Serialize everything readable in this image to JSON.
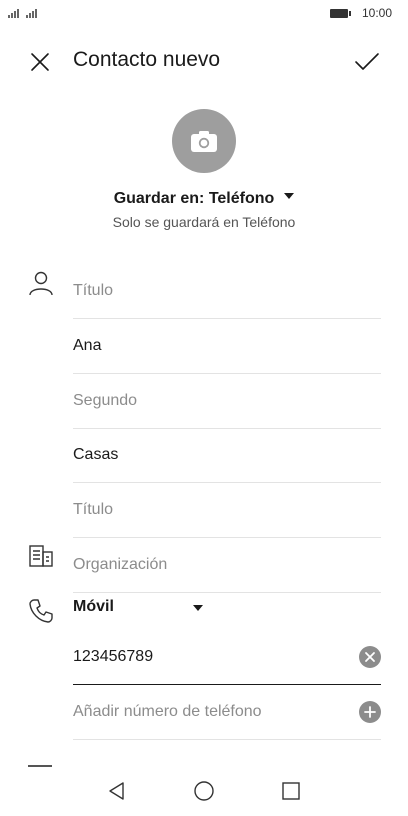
{
  "status": {
    "time": "10:00"
  },
  "header": {
    "title": "Contacto nuevo"
  },
  "storage": {
    "label": "Guardar en: Teléfono",
    "subtitle": "Solo se guardará en Teléfono"
  },
  "fields": {
    "prefix_placeholder": "Título",
    "first_name": "Ana",
    "middle_placeholder": "Segundo",
    "last_name": "Casas",
    "suffix_placeholder": "Título",
    "organization_placeholder": "Organización"
  },
  "phone": {
    "type": "Móvil",
    "number": "123456789",
    "add_placeholder": "Añadir número de teléfono"
  },
  "colors": {
    "accent_gray": "#9e9e9e",
    "text": "#1a1a1a",
    "placeholder": "#8c8c8c"
  }
}
